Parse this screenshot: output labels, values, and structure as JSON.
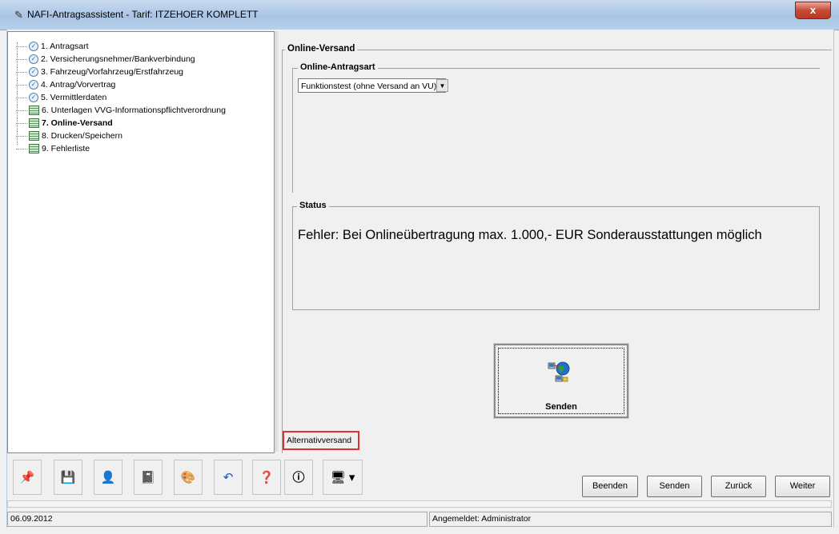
{
  "window": {
    "title": "NAFI-Antragsassistent - Tarif: ITZEHOER KOMPLETT",
    "close_glyph": "x",
    "title_icon": "pen-icon"
  },
  "tree": {
    "items": [
      {
        "label": "1. Antragsart",
        "icon": "check-icon",
        "bold": false
      },
      {
        "label": "2. Versicherungsnehmer/Bankverbindung",
        "icon": "check-icon",
        "bold": false
      },
      {
        "label": "3. Fahrzeug/Vorfahrzeug/Erstfahrzeug",
        "icon": "check-icon",
        "bold": false
      },
      {
        "label": "4. Antrag/Vorvertrag",
        "icon": "check-icon",
        "bold": false
      },
      {
        "label": "5. Vermittlerdaten",
        "icon": "check-icon",
        "bold": false
      },
      {
        "label": "6. Unterlagen VVG-Informationspflichtverordnung",
        "icon": "form-icon",
        "bold": false
      },
      {
        "label": "7. Online-Versand",
        "icon": "form-icon",
        "bold": true
      },
      {
        "label": "8. Drucken/Speichern",
        "icon": "form-icon",
        "bold": false
      },
      {
        "label": "9. Fehlerliste",
        "icon": "form-icon",
        "bold": false
      }
    ]
  },
  "main": {
    "section_title": "Online-Versand",
    "antragsart_legend": "Online-Antragsart",
    "antragsart_value": "Funktionstest (ohne Versand an VU)",
    "status_legend": "Status",
    "status_message": "Fehler: Bei Onlineübertragung max. 1.000,- EUR Sonderausstattungen möglich",
    "send_button_label": "Senden",
    "alternativ_label": "Alternativversand"
  },
  "toolbar": {
    "icons": [
      "pin-icon",
      "save-icon",
      "person-icon",
      "document-icon",
      "palette-icon",
      "undo-icon",
      "help-icon",
      "info-icon",
      "computer-icon"
    ]
  },
  "buttons": {
    "beenden": "Beenden",
    "senden": "Senden",
    "zurueck": "Zurück",
    "weiter": "Weiter"
  },
  "statusbar": {
    "date": "06.09.2012",
    "user": "Angemeldet: Administrator"
  },
  "colors": {
    "highlight_border": "#e0302f",
    "title_gradient": "#a9c4e3"
  }
}
